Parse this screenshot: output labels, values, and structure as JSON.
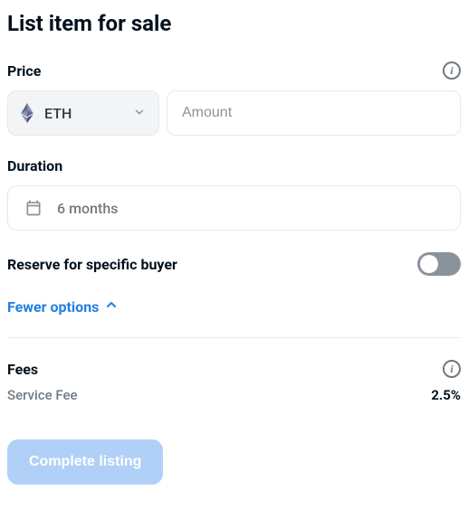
{
  "title": "List item for sale",
  "price": {
    "label": "Price",
    "currency": "ETH",
    "amount_placeholder": "Amount"
  },
  "duration": {
    "label": "Duration",
    "value": "6 months"
  },
  "reserve": {
    "label": "Reserve for specific buyer",
    "enabled": false
  },
  "options_toggle": {
    "label": "Fewer options"
  },
  "fees": {
    "label": "Fees",
    "items": [
      {
        "name": "Service Fee",
        "value": "2.5%"
      }
    ]
  },
  "submit": {
    "label": "Complete listing"
  }
}
